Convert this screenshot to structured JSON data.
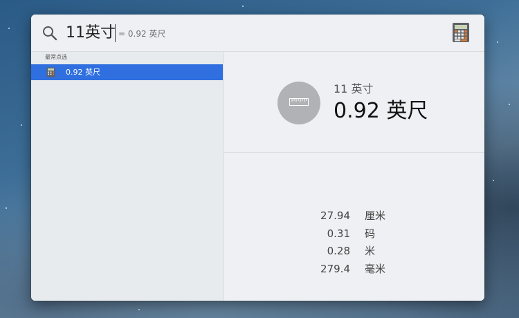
{
  "search": {
    "query": "11英寸",
    "inline_result": "= 0.92 英尺"
  },
  "results": {
    "section_header": "最常点选",
    "items": [
      {
        "label": "0.92 英尺",
        "selected": true
      }
    ]
  },
  "preview": {
    "subtitle": "11 英寸",
    "title": "0.92 英尺",
    "conversions": [
      {
        "value": "27.94",
        "unit": "厘米"
      },
      {
        "value": "0.31",
        "unit": "码"
      },
      {
        "value": "0.28",
        "unit": "米"
      },
      {
        "value": "279.4",
        "unit": "毫米"
      }
    ]
  },
  "icons": {
    "search": "magnifier-icon",
    "app": "calculator-icon",
    "result_row": "calculator-icon",
    "preview": "ruler-icon"
  },
  "colors": {
    "selection": "#2f6fe0",
    "window_background": "#eef0f3"
  }
}
